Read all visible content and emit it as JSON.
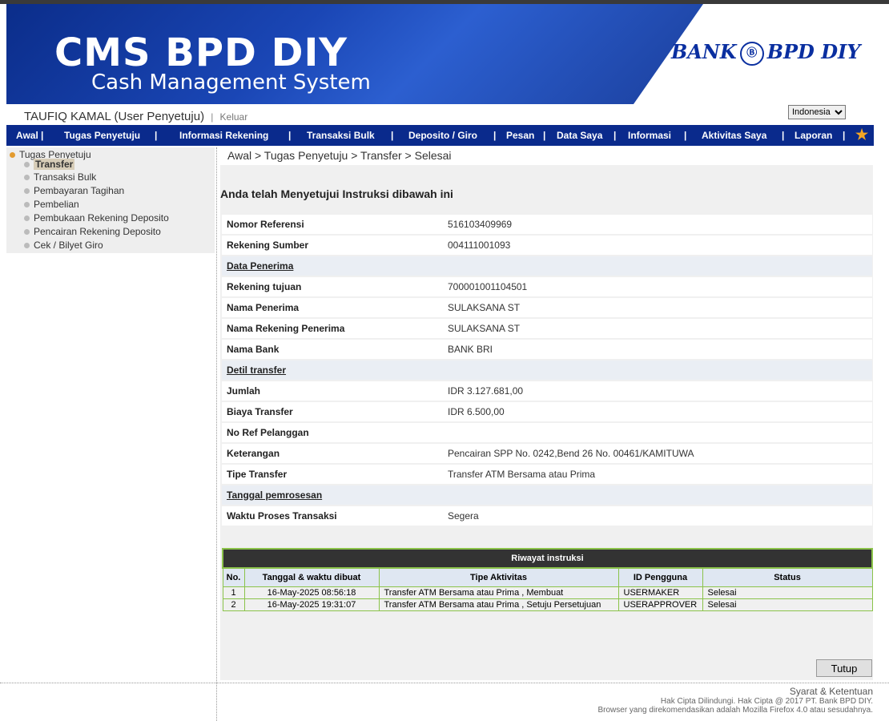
{
  "banner": {
    "title": "CMS BPD DIY",
    "subtitle": "Cash Management System",
    "logo_text_left": "BANK",
    "logo_text_right": "BPD DIY"
  },
  "user": {
    "name": "TAUFIQ KAMAL (User Penyetuju)",
    "logout": "Keluar"
  },
  "language": {
    "selected": "Indonesia"
  },
  "nav": {
    "items": [
      "Awal",
      "Tugas Penyetuju",
      "Informasi Rekening",
      "Transaksi Bulk",
      "Deposito / Giro",
      "Pesan",
      "Data Saya",
      "Informasi",
      "Aktivitas Saya",
      "Laporan"
    ]
  },
  "sidebar": {
    "root": "Tugas Penyetuju",
    "items": [
      "Transfer",
      "Transaksi Bulk",
      "Pembayaran Tagihan",
      "Pembelian",
      "Pembukaan Rekening Deposito",
      "Pencairan Rekening Deposito",
      "Cek / Bilyet Giro"
    ]
  },
  "breadcrumb": "Awal > Tugas Penyetuju > Transfer > Selesai",
  "heading": "Anda telah Menyetujui Instruksi dibawah ini",
  "detail": {
    "nomor_referensi": {
      "label": "Nomor Referensi",
      "value": "516103409969"
    },
    "rekening_sumber": {
      "label": "Rekening Sumber",
      "value": "004111001093"
    },
    "section_penerima": "Data Penerima",
    "rekening_tujuan": {
      "label": "Rekening tujuan",
      "value": "700001001104501"
    },
    "nama_penerima": {
      "label": "Nama Penerima",
      "value": "SULAKSANA ST"
    },
    "nama_rekening_penerima": {
      "label": "Nama Rekening Penerima",
      "value": "SULAKSANA ST"
    },
    "nama_bank": {
      "label": "Nama Bank",
      "value": "BANK BRI"
    },
    "section_transfer": "Detil transfer",
    "jumlah": {
      "label": "Jumlah",
      "value": "IDR  3.127.681,00"
    },
    "biaya": {
      "label": "Biaya Transfer",
      "value": "IDR  6.500,00"
    },
    "no_ref": {
      "label": "No Ref Pelanggan",
      "value": ""
    },
    "keterangan": {
      "label": "Keterangan",
      "value": "Pencairan SPP No. 0242,Bend 26 No. 00461/KAMITUWA"
    },
    "tipe": {
      "label": "Tipe Transfer",
      "value": "Transfer ATM Bersama atau Prima"
    },
    "section_tanggal": "Tanggal pemrosesan",
    "waktu": {
      "label": "Waktu Proses Transaksi",
      "value": "Segera"
    }
  },
  "history": {
    "caption": "Riwayat instruksi",
    "headers": [
      "No.",
      "Tanggal & waktu dibuat",
      "Tipe Aktivitas",
      "ID Pengguna",
      "Status"
    ],
    "rows": [
      [
        "1",
        "16-May-2025 08:56:18",
        "Transfer ATM Bersama atau Prima    ,  Membuat",
        "USERMAKER",
        "Selesai"
      ],
      [
        "2",
        "16-May-2025 19:31:07",
        "Transfer ATM Bersama atau Prima    ,  Setuju Persetujuan",
        "USERAPPROVER",
        "Selesai"
      ]
    ]
  },
  "buttons": {
    "tutup": "Tutup"
  },
  "footer": {
    "terms": "Syarat & Ketentuan",
    "copyright": "Hak Cipta Dilindungi. Hak Cipta @ 2017 PT. Bank BPD DIY.",
    "browser": "Browser yang direkomendasikan adalah Mozilla Firefox 4.0 atau sesudahnya."
  },
  "colors": {
    "nav_bg": "#0a2a8c",
    "banner_blue": "#1a46b5",
    "history_border": "#8bc34a"
  }
}
